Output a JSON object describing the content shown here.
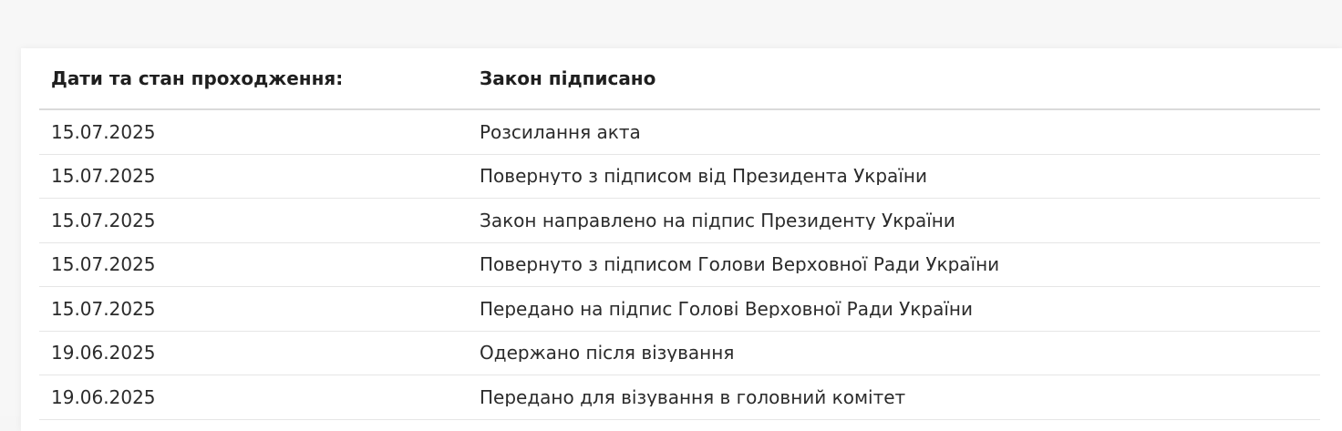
{
  "table": {
    "header": {
      "left": "Дати та стан проходження:",
      "right": "Закон підписано"
    },
    "rows": [
      {
        "date": "15.07.2025",
        "status": "Розсилання акта"
      },
      {
        "date": "15.07.2025",
        "status": "Повернуто з підписом від Президента України"
      },
      {
        "date": "15.07.2025",
        "status": "Закон направлено на підпис Президенту України"
      },
      {
        "date": "15.07.2025",
        "status": "Повернуто з підписом Голови Верховної Ради України"
      },
      {
        "date": "15.07.2025",
        "status": "Передано на підпис Голові Верховної Ради України"
      },
      {
        "date": "19.06.2025",
        "status": "Одержано після візування"
      },
      {
        "date": "19.06.2025",
        "status": "Передано для візування в головний комітет"
      }
    ]
  }
}
